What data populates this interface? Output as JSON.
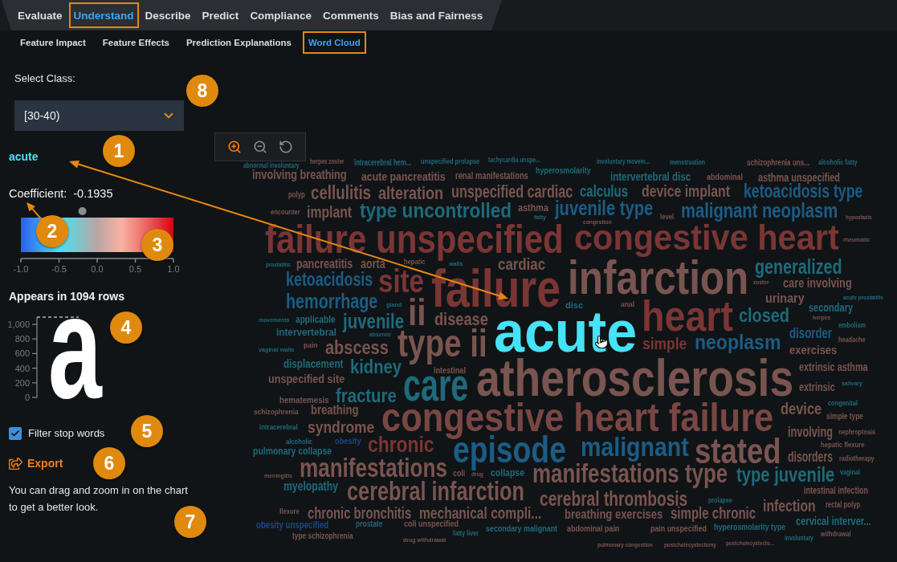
{
  "top_tabs": [
    {
      "label": "Evaluate",
      "selected": false,
      "outlined": false
    },
    {
      "label": "Understand",
      "selected": true,
      "outlined": true
    },
    {
      "label": "Describe",
      "selected": false,
      "outlined": false
    },
    {
      "label": "Predict",
      "selected": false,
      "outlined": false
    },
    {
      "label": "Compliance",
      "selected": false,
      "outlined": false
    },
    {
      "label": "Comments",
      "selected": false,
      "outlined": false
    },
    {
      "label": "Bias and Fairness",
      "selected": false,
      "outlined": false
    }
  ],
  "sub_tabs": [
    {
      "label": "Feature Impact",
      "selected": false,
      "outlined": false
    },
    {
      "label": "Feature Effects",
      "selected": false,
      "outlined": false
    },
    {
      "label": "Prediction Explanations",
      "selected": false,
      "outlined": false
    },
    {
      "label": "Word Cloud",
      "selected": true,
      "outlined": true
    }
  ],
  "class_selector": {
    "label": "Select Class:",
    "value": "[30-40)"
  },
  "chart_toolbar": [
    {
      "kind": "zoom_in",
      "active": true
    },
    {
      "kind": "zoom_out",
      "active": false
    },
    {
      "kind": "reset",
      "active": false
    }
  ],
  "selected_word": {
    "word": "acute",
    "coefficient_label": "Coefficient:",
    "coefficient": "-0.1935"
  },
  "coefficient_scale": {
    "level": 0.4033,
    "ticks": [
      "-1.0",
      "-0.5",
      "0.0",
      "0.5",
      "1.0"
    ]
  },
  "occurrence": {
    "title": "Appears in 1094 rows",
    "glyph": "a",
    "axis_labels": [
      "1,000",
      "800",
      "600",
      "400",
      "200",
      "0"
    ]
  },
  "filter_stop_words": {
    "label": "Filter stop words",
    "checked": true
  },
  "export": {
    "label": "Export"
  },
  "hint": "You can drag and zoom in on the chart to get a better look.",
  "word_cloud": {
    "words": [
      {
        "text": "abnormal involuntary",
        "color": "#1f6a7c",
        "selected": false
      },
      {
        "text": "herpes zoster",
        "color": "#7a5450",
        "selected": false
      },
      {
        "text": "intracerebral hem...",
        "color": "#1f6a7c",
        "selected": false
      },
      {
        "text": "unspecified prolapse",
        "color": "#1f6a7c",
        "selected": false
      },
      {
        "text": "tachycardia unspe...",
        "color": "#1f6a7c",
        "selected": false
      },
      {
        "text": "involuntary movem...",
        "color": "#1f6a7c",
        "selected": false
      },
      {
        "text": "menstruation",
        "color": "#1f6a7c",
        "selected": false
      },
      {
        "text": "schizophrenia uns...",
        "color": "#7a5450",
        "selected": false
      },
      {
        "text": "alcoholic fatty",
        "color": "#1f6a7c",
        "selected": false
      },
      {
        "text": "involving breathing",
        "color": "#7a5450",
        "selected": false
      },
      {
        "text": "acute pancreatitis",
        "color": "#7a5450",
        "selected": false
      },
      {
        "text": "renal manifestations",
        "color": "#7a5450",
        "selected": false
      },
      {
        "text": "hyperosmolarity",
        "color": "#1f6a7c",
        "selected": false
      },
      {
        "text": "intervertebral disc",
        "color": "#1f6a7c",
        "selected": false
      },
      {
        "text": "abdominal",
        "color": "#7a5450",
        "selected": false
      },
      {
        "text": "asthma unspecified",
        "color": "#7a5450",
        "selected": false
      },
      {
        "text": "polyp",
        "color": "#7a5450",
        "selected": false
      },
      {
        "text": "cellulitis",
        "color": "#7a5450",
        "selected": false
      },
      {
        "text": "alteration",
        "color": "#7a5450",
        "selected": false
      },
      {
        "text": "unspecified cardiac",
        "color": "#7a5450",
        "selected": false
      },
      {
        "text": "calculus",
        "color": "#1f6a7c",
        "selected": false
      },
      {
        "text": "device implant",
        "color": "#7a5450",
        "selected": false
      },
      {
        "text": "ketoacidosis type",
        "color": "#1c5c85",
        "selected": false
      },
      {
        "text": "encounter",
        "color": "#7a5450",
        "selected": false
      },
      {
        "text": "implant",
        "color": "#7a5450",
        "selected": false
      },
      {
        "text": "type uncontrolled",
        "color": "#1f6a7c",
        "selected": false
      },
      {
        "text": "asthma",
        "color": "#7a5450",
        "selected": false
      },
      {
        "text": "fatty",
        "color": "#1f6a7c",
        "selected": false
      },
      {
        "text": "juvenile type",
        "color": "#1c5c85",
        "selected": false
      },
      {
        "text": "congestion",
        "color": "#7a5450",
        "selected": false
      },
      {
        "text": "level",
        "color": "#7a5450",
        "selected": false
      },
      {
        "text": "malignant neoplasm",
        "color": "#1c5c85",
        "selected": false
      },
      {
        "text": "hypostasis",
        "color": "#7a5450",
        "selected": false
      },
      {
        "text": "failure unspecified",
        "color": "#7a3535",
        "selected": false
      },
      {
        "text": "congestive heart",
        "color": "#7a3535",
        "selected": false
      },
      {
        "text": "rheumatic",
        "color": "#7a5450",
        "selected": false
      },
      {
        "text": "prostatitis",
        "color": "#1f6a7c",
        "selected": false
      },
      {
        "text": "pancreatitis",
        "color": "#7a5450",
        "selected": false
      },
      {
        "text": "aorta",
        "color": "#7a5450",
        "selected": false
      },
      {
        "text": "hepatic",
        "color": "#7a5450",
        "selected": false
      },
      {
        "text": "walls",
        "color": "#1f6a7c",
        "selected": false
      },
      {
        "text": "cardiac",
        "color": "#7a5450",
        "selected": false
      },
      {
        "text": "infarction",
        "color": "#7a5450",
        "selected": false
      },
      {
        "text": "generalized",
        "color": "#1f6a7c",
        "selected": false
      },
      {
        "text": "ketoacidosis",
        "color": "#1c5c85",
        "selected": false
      },
      {
        "text": "site",
        "color": "#7a3535",
        "selected": false
      },
      {
        "text": "failure",
        "color": "#7a3535",
        "selected": false
      },
      {
        "text": "zoster",
        "color": "#7a5450",
        "selected": false
      },
      {
        "text": "care involving",
        "color": "#7a5450",
        "selected": false
      },
      {
        "text": "hemorrhage",
        "color": "#1c5c85",
        "selected": false
      },
      {
        "text": "gland",
        "color": "#1f6a7c",
        "selected": false
      },
      {
        "text": "ii",
        "color": "#7a5450",
        "selected": false
      },
      {
        "text": "disc",
        "color": "#1f6a7c",
        "selected": false
      },
      {
        "text": "anal",
        "color": "#7a5450",
        "selected": false
      },
      {
        "text": "urinary",
        "color": "#7a5450",
        "selected": false
      },
      {
        "text": "acute prostatitis",
        "color": "#1f6a7c",
        "selected": false
      },
      {
        "text": "secondary",
        "color": "#1f6a7c",
        "selected": false
      },
      {
        "text": "movements",
        "color": "#1f6a7c",
        "selected": false
      },
      {
        "text": "applicable",
        "color": "#1f6a7c",
        "selected": false
      },
      {
        "text": "juvenile",
        "color": "#1f6a7c",
        "selected": false
      },
      {
        "text": "disease",
        "color": "#7a5450",
        "selected": false
      },
      {
        "text": "acute",
        "selected": true
      },
      {
        "text": "heart",
        "color": "#7a3535",
        "selected": false
      },
      {
        "text": "closed",
        "color": "#1f6a7c",
        "selected": false
      },
      {
        "text": "herpes",
        "color": "#7a5450",
        "selected": false
      },
      {
        "text": "embolism",
        "color": "#1f6a7c",
        "selected": false
      },
      {
        "text": "intervertebral",
        "color": "#1f6a7c",
        "selected": false
      },
      {
        "text": "absence",
        "color": "#1f6a7c",
        "selected": false
      },
      {
        "text": "type ii",
        "color": "#7a5450",
        "selected": false
      },
      {
        "text": "simple",
        "color": "#7a3535",
        "selected": false
      },
      {
        "text": "neoplasm",
        "color": "#1c5c85",
        "selected": false
      },
      {
        "text": "disorder",
        "color": "#1c5c85",
        "selected": false
      },
      {
        "text": "headache",
        "color": "#7a5450",
        "selected": false
      },
      {
        "text": "vaginal walls",
        "color": "#1f6a7c",
        "selected": false
      },
      {
        "text": "pain",
        "color": "#7a5450",
        "selected": false
      },
      {
        "text": "abscess",
        "color": "#7a5450",
        "selected": false
      },
      {
        "text": "exercises",
        "color": "#7a5450",
        "selected": false
      },
      {
        "text": "displacement",
        "color": "#1f6a7c",
        "selected": false
      },
      {
        "text": "kidney",
        "color": "#1f6a7c",
        "selected": false
      },
      {
        "text": "intestinal",
        "color": "#7a5450",
        "selected": false
      },
      {
        "text": "atherosclerosis",
        "color": "#7a5450",
        "selected": false
      },
      {
        "text": "extrinsic asthma",
        "color": "#7a5450",
        "selected": false
      },
      {
        "text": "unspecified site",
        "color": "#7a5450",
        "selected": false
      },
      {
        "text": "care",
        "color": "#1f6a7c",
        "selected": false
      },
      {
        "text": "extrinsic",
        "color": "#7a5450",
        "selected": false
      },
      {
        "text": "salivary",
        "color": "#1f6a7c",
        "selected": false
      },
      {
        "text": "hematemesis",
        "color": "#7a5450",
        "selected": false
      },
      {
        "text": "fracture",
        "color": "#1f6a7c",
        "selected": false
      },
      {
        "text": "congestive heart failure",
        "color": "#7a4643",
        "selected": false
      },
      {
        "text": "device",
        "color": "#7a5450",
        "selected": false
      },
      {
        "text": "congenital",
        "color": "#1f6a7c",
        "selected": false
      },
      {
        "text": "schizophrenia",
        "color": "#7a5450",
        "selected": false
      },
      {
        "text": "breathing",
        "color": "#7a5450",
        "selected": false
      },
      {
        "text": "simple type",
        "color": "#7a5450",
        "selected": false
      },
      {
        "text": "intracerebral",
        "color": "#1f6a7c",
        "selected": false
      },
      {
        "text": "syndrome",
        "color": "#7a5450",
        "selected": false
      },
      {
        "text": "involving",
        "color": "#7a5450",
        "selected": false
      },
      {
        "text": "nephroptosis",
        "color": "#7a5450",
        "selected": false
      },
      {
        "text": "alcoholic",
        "color": "#1f6a7c",
        "selected": false
      },
      {
        "text": "obesity",
        "color": "#1d4787",
        "selected": false
      },
      {
        "text": "chronic",
        "color": "#7a3535",
        "selected": false
      },
      {
        "text": "episode",
        "color": "#1c5c85",
        "selected": false
      },
      {
        "text": "malignant",
        "color": "#1c5c85",
        "selected": false
      },
      {
        "text": "stated",
        "color": "#7a5450",
        "selected": false
      },
      {
        "text": "hepatic flexure",
        "color": "#7a5450",
        "selected": false
      },
      {
        "text": "pulmonary collapse",
        "color": "#1f6a7c",
        "selected": false
      },
      {
        "text": "disorders",
        "color": "#7a5450",
        "selected": false
      },
      {
        "text": "radiotherapy",
        "color": "#7a5450",
        "selected": false
      },
      {
        "text": "meningitis",
        "color": "#7a5450",
        "selected": false
      },
      {
        "text": "manifestations",
        "color": "#7a5450",
        "selected": false
      },
      {
        "text": "coli",
        "color": "#7a5450",
        "selected": false
      },
      {
        "text": "drug",
        "color": "#7a5450",
        "selected": false
      },
      {
        "text": "collapse",
        "color": "#1f6a7c",
        "selected": false
      },
      {
        "text": "manifestations type",
        "color": "#7a5450",
        "selected": false
      },
      {
        "text": "type juvenile",
        "color": "#1f6a7c",
        "selected": false
      },
      {
        "text": "vaginal",
        "color": "#1f6a7c",
        "selected": false
      },
      {
        "text": "myelopathy",
        "color": "#1f6a7c",
        "selected": false
      },
      {
        "text": "cerebral infarction",
        "color": "#7a5450",
        "selected": false
      },
      {
        "text": "intestinal infection",
        "color": "#7a5450",
        "selected": false
      },
      {
        "text": "cerebral thrombosis",
        "color": "#7a5450",
        "selected": false
      },
      {
        "text": "prolapse",
        "color": "#1f6a7c",
        "selected": false
      },
      {
        "text": "infection",
        "color": "#7a5450",
        "selected": false
      },
      {
        "text": "rectal polyp",
        "color": "#7a5450",
        "selected": false
      },
      {
        "text": "flexure",
        "color": "#7a5450",
        "selected": false
      },
      {
        "text": "chronic bronchitis",
        "color": "#7a5450",
        "selected": false
      },
      {
        "text": "mechanical compli...",
        "color": "#7a5450",
        "selected": false
      },
      {
        "text": "breathing exercises",
        "color": "#7a5450",
        "selected": false
      },
      {
        "text": "simple chronic",
        "color": "#7a5450",
        "selected": false
      },
      {
        "text": "obesity unspecified",
        "color": "#1d4787",
        "selected": false
      },
      {
        "text": "prostate",
        "color": "#1f6a7c",
        "selected": false
      },
      {
        "text": "coli unspecified",
        "color": "#7a5450",
        "selected": false
      },
      {
        "text": "secondary malignant",
        "color": "#1f6a7c",
        "selected": false
      },
      {
        "text": "abdominal pain",
        "color": "#7a5450",
        "selected": false
      },
      {
        "text": "pain unspecified",
        "color": "#7a5450",
        "selected": false
      },
      {
        "text": "hyperosmolarity type",
        "color": "#1f6a7c",
        "selected": false
      },
      {
        "text": "cervical interver...",
        "color": "#1f6a7c",
        "selected": false
      },
      {
        "text": "type schizophrenia",
        "color": "#7a5450",
        "selected": false
      },
      {
        "text": "fatty liver",
        "color": "#1f6a7c",
        "selected": false
      },
      {
        "text": "involuntary",
        "color": "#1f6a7c",
        "selected": false
      },
      {
        "text": "withdrawal",
        "color": "#7a5450",
        "selected": false
      },
      {
        "text": "drug withdrawal",
        "color": "#7a5450",
        "selected": false
      },
      {
        "text": "pulmonary congestion",
        "color": "#7a5450",
        "selected": false
      },
      {
        "text": "postcholecystectomy",
        "color": "#7a5450",
        "selected": false
      },
      {
        "text": "postcholecystecto...",
        "color": "#7a5450",
        "selected": false
      }
    ]
  },
  "callouts": [
    "1",
    "2",
    "3",
    "4",
    "5",
    "6",
    "7",
    "8"
  ]
}
